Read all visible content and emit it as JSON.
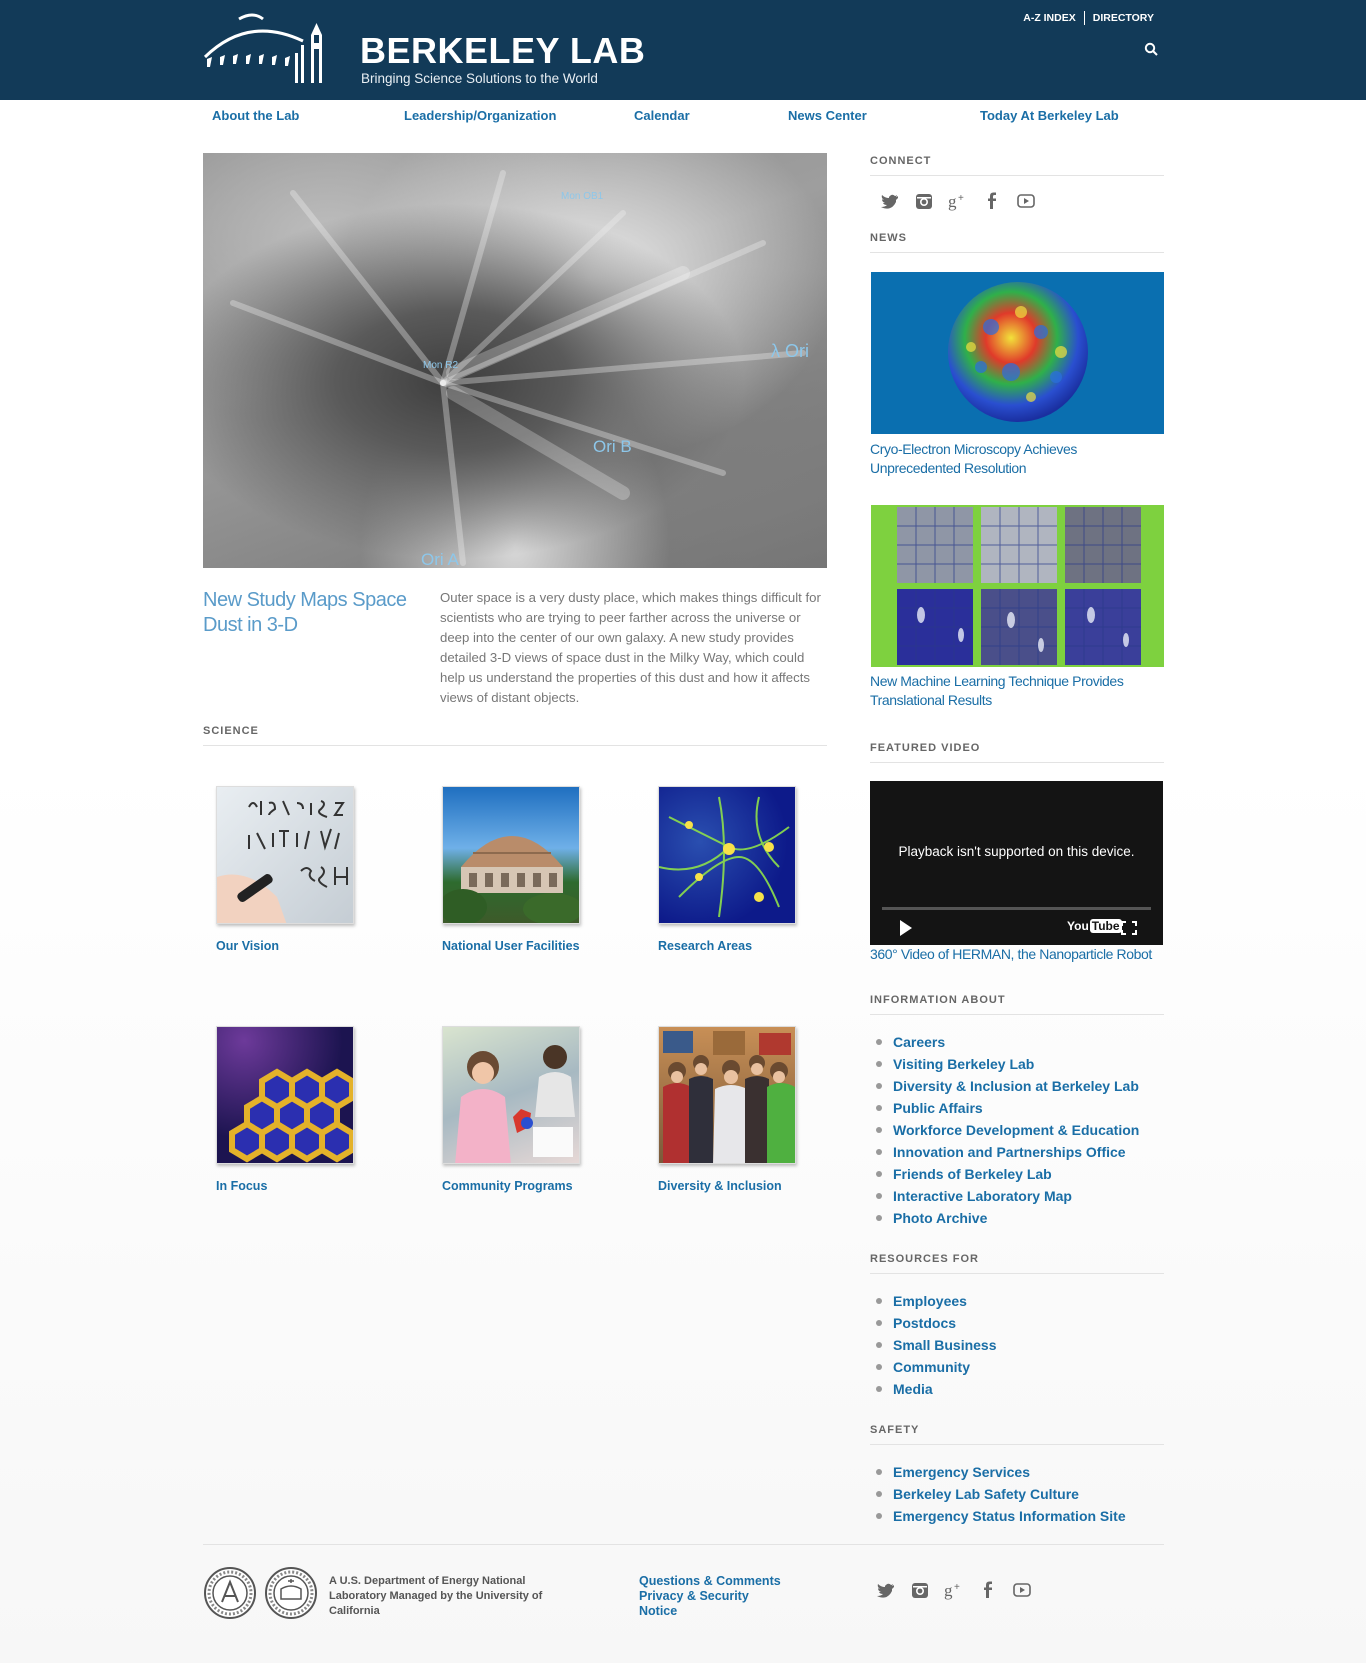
{
  "header": {
    "brand_title": "BERKELEY LAB",
    "brand_tagline": "Bringing Science Solutions to the World",
    "util_links": [
      "A-Z INDEX",
      "DIRECTORY"
    ]
  },
  "nav": [
    "About the Lab",
    "Leadership/Organization",
    "Calendar",
    "News Center",
    "Today At Berkeley Lab"
  ],
  "hero": {
    "image_labels": [
      "Mon OB1",
      "Mon R2",
      "λ Ori",
      "Ori B",
      "Ori A"
    ],
    "title": "New Study Maps Space Dust in 3-D",
    "description": "Outer space is a very dusty place, which makes things difficult for scientists who are trying to peer farther across the universe or deep into the center of our own galaxy. A new study provides detailed 3-D views of space dust in the Milky Way, which could help us understand the properties of this dust and how it affects views of distant objects."
  },
  "science": {
    "heading": "SCIENCE",
    "tiles": [
      {
        "label": "Our Vision"
      },
      {
        "label": "National User Facilities"
      },
      {
        "label": "Research Areas"
      },
      {
        "label": "In Focus"
      },
      {
        "label": "Community Programs"
      },
      {
        "label": "Diversity & Inclusion"
      }
    ]
  },
  "sidebar": {
    "connect_heading": "CONNECT",
    "social_icons": [
      "twitter-icon",
      "instagram-icon",
      "google-plus-icon",
      "facebook-icon",
      "youtube-icon"
    ],
    "news_heading": "NEWS",
    "news": [
      {
        "caption": "Cryo-Electron Microscopy Achieves Unprecedented Resolution"
      },
      {
        "caption": "New Machine Learning Technique Provides Translational Results"
      }
    ],
    "video_heading": "FEATURED VIDEO",
    "video_message": "Playback isn't supported on this device.",
    "video_logo": "You",
    "video_logo_tube": "Tube",
    "video_caption": "360° Video of HERMAN, the Nanoparticle Robot",
    "info_heading": "INFORMATION ABOUT",
    "info_links": [
      "Careers",
      "Visiting Berkeley Lab",
      "Diversity & Inclusion at Berkeley Lab",
      "Public Affairs",
      "Workforce Development & Education",
      "Innovation and Partnerships Office",
      "Friends of Berkeley Lab",
      "Interactive Laboratory Map",
      "Photo Archive"
    ],
    "resources_heading": "RESOURCES FOR",
    "resources_links": [
      "Employees",
      "Postdocs",
      "Small Business",
      "Community",
      "Media"
    ],
    "safety_heading": "SAFETY",
    "safety_links": [
      "Emergency Services",
      "Berkeley Lab Safety Culture",
      "Emergency Status Information Site"
    ]
  },
  "footer": {
    "text": "A U.S. Department of Energy National Laboratory Managed by the University of California",
    "links": [
      "Questions & Comments",
      "Privacy & Security",
      "Notice"
    ]
  },
  "colors": {
    "header_bg": "#123a58",
    "link": "#1a6ea6",
    "news1_bg": "#0a6fb0",
    "news2_bg": "#7ed13f"
  }
}
